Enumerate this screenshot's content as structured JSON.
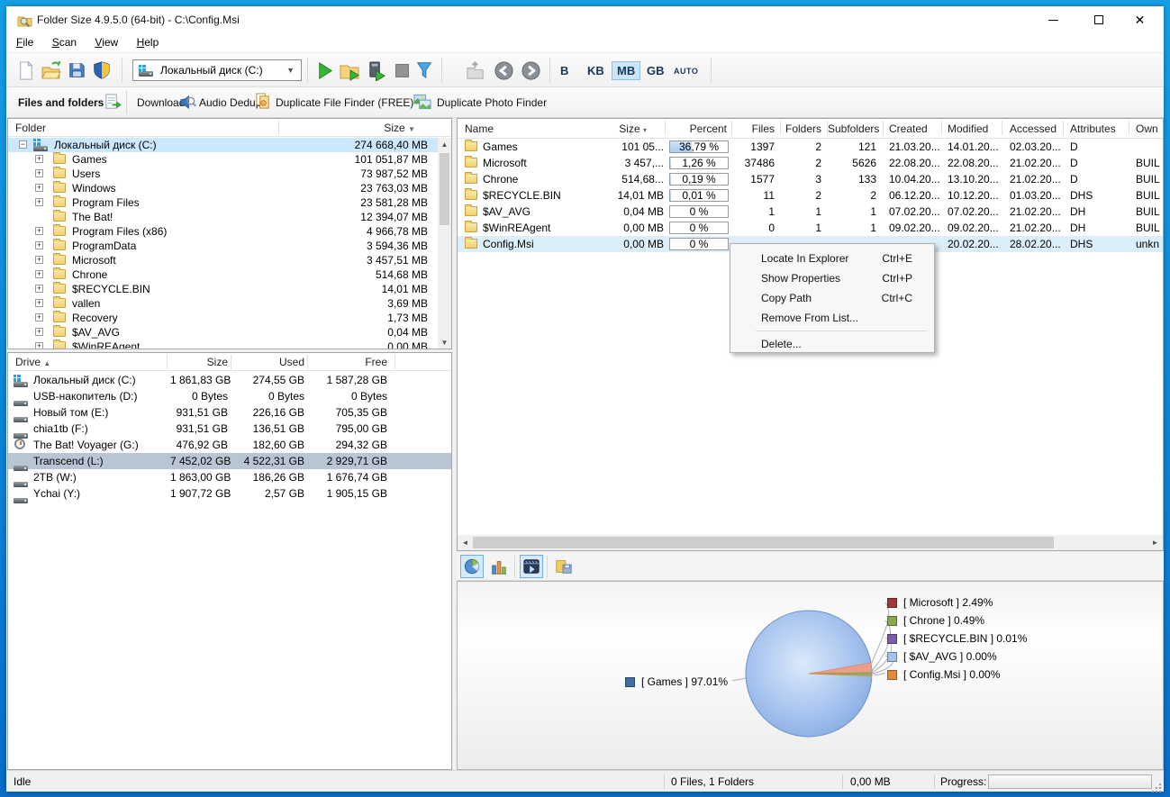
{
  "window": {
    "title": "Folder Size 4.9.5.0 (64-bit) - C:\\Config.Msi"
  },
  "menu": {
    "items": [
      "File",
      "Scan",
      "View",
      "Help"
    ]
  },
  "toolbar": {
    "drive_combo": "Локальный диск (C:)",
    "units": [
      "B",
      "KB",
      "MB",
      "GB",
      "AUTO"
    ],
    "selected_unit": "MB"
  },
  "toolbar2": {
    "mode_button": "Files and folders",
    "download_label": "Download:",
    "audio_dedupe": "Audio Dedupe",
    "dup_file_finder": "Duplicate File Finder (FREE)",
    "dup_photo_finder": "Duplicate Photo Finder"
  },
  "folder_tree": {
    "header_folder": "Folder",
    "header_size": "Size",
    "sort_glyph": "▼",
    "rows": [
      {
        "expand": "−",
        "name": "Локальный диск (C:)",
        "size": "274 668,40 MB",
        "selected": true
      },
      {
        "expand": "+",
        "name": "Games",
        "size": "101 051,87 MB"
      },
      {
        "expand": "+",
        "name": "Users",
        "size": "73 987,52 MB"
      },
      {
        "expand": "+",
        "name": "Windows",
        "size": "23 763,03 MB"
      },
      {
        "expand": "+",
        "name": "Program Files",
        "size": "23 581,28 MB"
      },
      {
        "expand": "",
        "name": "The Bat!",
        "size": "12 394,07 MB"
      },
      {
        "expand": "+",
        "name": "Program Files (x86)",
        "size": "4 966,78 MB"
      },
      {
        "expand": "+",
        "name": "ProgramData",
        "size": "3 594,36 MB"
      },
      {
        "expand": "+",
        "name": "Microsoft",
        "size": "3 457,51 MB"
      },
      {
        "expand": "+",
        "name": "Chrone",
        "size": "514,68 MB"
      },
      {
        "expand": "+",
        "name": "$RECYCLE.BIN",
        "size": "14,01 MB"
      },
      {
        "expand": "+",
        "name": "vallen",
        "size": "3,69 MB"
      },
      {
        "expand": "+",
        "name": "Recovery",
        "size": "1,73 MB"
      },
      {
        "expand": "+",
        "name": "$AV_AVG",
        "size": "0,04 MB"
      },
      {
        "expand": "+",
        "name": "$WinREAgent",
        "size": "0,00 MB"
      }
    ]
  },
  "drive_list": {
    "headers": {
      "drive": "Drive",
      "size": "Size",
      "used": "Used",
      "free": "Free",
      "sort_glyph": "▲"
    },
    "rows": [
      {
        "name": "Локальный диск (C:)",
        "size": "1 861,83 GB",
        "used": "274,55 GB",
        "free": "1 587,28 GB"
      },
      {
        "name": "USB-накопитель (D:)",
        "size": "0 Bytes",
        "used": "0 Bytes",
        "free": "0 Bytes"
      },
      {
        "name": "Новый том (E:)",
        "size": "931,51 GB",
        "used": "226,16 GB",
        "free": "705,35 GB"
      },
      {
        "name": "chia1tb (F:)",
        "size": "931,51 GB",
        "used": "136,51 GB",
        "free": "795,00 GB"
      },
      {
        "name": "The Bat! Voyager (G:)",
        "size": "476,92 GB",
        "used": "182,60 GB",
        "free": "294,32 GB"
      },
      {
        "name": "Transcend (L:)",
        "size": "7 452,02 GB",
        "used": "4 522,31 GB",
        "free": "2 929,71 GB",
        "selected": true
      },
      {
        "name": "2TB (W:)",
        "size": "1 863,00 GB",
        "used": "186,26 GB",
        "free": "1 676,74 GB"
      },
      {
        "name": "Ychai (Y:)",
        "size": "1 907,72 GB",
        "used": "2,57 GB",
        "free": "1 905,15 GB"
      }
    ]
  },
  "file_list": {
    "headers": {
      "name": "Name",
      "size": "Size",
      "percent": "Percent",
      "files": "Files",
      "folders": "Folders",
      "subfolders": "Subfolders",
      "created": "Created",
      "modified": "Modified",
      "accessed": "Accessed",
      "attributes": "Attributes",
      "owner": "Own",
      "size_sort_glyph": "▾"
    },
    "rows": [
      {
        "name": "Games",
        "size": "101 05...",
        "percent": "36,79 %",
        "fill": 36.79,
        "files": "1397",
        "folders": "2",
        "subfolders": "121",
        "created": "21.03.20...",
        "modified": "14.01.20...",
        "accessed": "02.03.20...",
        "attributes": "D",
        "owner": ""
      },
      {
        "name": "Microsoft",
        "size": "3 457,...",
        "percent": "1,26 %",
        "fill": 1.26,
        "files": "37486",
        "folders": "2",
        "subfolders": "5626",
        "created": "22.08.20...",
        "modified": "22.08.20...",
        "accessed": "21.02.20...",
        "attributes": "D",
        "owner": "BUIL"
      },
      {
        "name": "Chrone",
        "size": "514,68...",
        "percent": "0,19 %",
        "fill": 0.19,
        "files": "1577",
        "folders": "3",
        "subfolders": "133",
        "created": "10.04.20...",
        "modified": "13.10.20...",
        "accessed": "21.02.20...",
        "attributes": "D",
        "owner": "BUIL"
      },
      {
        "name": "$RECYCLE.BIN",
        "size": "14,01 MB",
        "percent": "0,01 %",
        "fill": 0.01,
        "files": "11",
        "folders": "2",
        "subfolders": "2",
        "created": "06.12.20...",
        "modified": "10.12.20...",
        "accessed": "01.03.20...",
        "attributes": "DHS",
        "owner": "BUIL"
      },
      {
        "name": "$AV_AVG",
        "size": "0,04 MB",
        "percent": "0 %",
        "fill": 0,
        "files": "1",
        "folders": "1",
        "subfolders": "1",
        "created": "07.02.20...",
        "modified": "07.02.20...",
        "accessed": "21.02.20...",
        "attributes": "DH",
        "owner": "BUIL"
      },
      {
        "name": "$WinREAgent",
        "size": "0,00 MB",
        "percent": "0 %",
        "fill": 0,
        "files": "0",
        "folders": "1",
        "subfolders": "1",
        "created": "09.02.20...",
        "modified": "09.02.20...",
        "accessed": "21.02.20...",
        "attributes": "DH",
        "owner": "BUIL"
      },
      {
        "name": "Config.Msi",
        "size": "0,00 MB",
        "percent": "0 %",
        "fill": 0,
        "files": "",
        "folders": "",
        "subfolders": "",
        "created": "",
        "modified": "20.02.20...",
        "accessed": "28.02.20...",
        "attributes": "DHS",
        "owner": "unkn",
        "selected": true
      }
    ]
  },
  "context_menu": {
    "items": [
      {
        "label": "Locate In Explorer",
        "shortcut": "Ctrl+E"
      },
      {
        "label": "Show Properties",
        "shortcut": "Ctrl+P"
      },
      {
        "label": "Copy Path",
        "shortcut": "Ctrl+C"
      },
      {
        "label": "Remove From List...",
        "shortcut": ""
      },
      {
        "label": "Delete...",
        "shortcut": ""
      }
    ]
  },
  "chart_data": {
    "type": "pie",
    "legend_position": "right",
    "slices": [
      {
        "label": "Games",
        "value": 97.01,
        "color": "#3f6ea5",
        "legend": "[ Games ] 97.01%"
      },
      {
        "label": "Microsoft",
        "value": 2.49,
        "color": "#9c3a38",
        "legend": "[ Microsoft ] 2.49%"
      },
      {
        "label": "Chrone",
        "value": 0.49,
        "color": "#89a84c",
        "legend": "[ Chrone ] 0.49%"
      },
      {
        "label": "$RECYCLE.BIN",
        "value": 0.01,
        "color": "#7a5da8",
        "legend": "[ $RECYCLE.BIN ] 0.01%"
      },
      {
        "label": "$AV_AVG",
        "value": 0.0,
        "color": "#a3c4e8",
        "legend": "[ $AV_AVG ] 0.00%"
      },
      {
        "label": "Config.Msi",
        "value": 0.0,
        "color": "#e08b38",
        "legend": "[ Config.Msi ] 0.00%"
      }
    ],
    "pie_fill": "#8fb2e8",
    "wedge_fill": "#eb9c8a"
  },
  "status_bar": {
    "state": "Idle",
    "files": "0 Files, 1 Folders",
    "size": "0,00 MB",
    "progress_label": "Progress:"
  }
}
